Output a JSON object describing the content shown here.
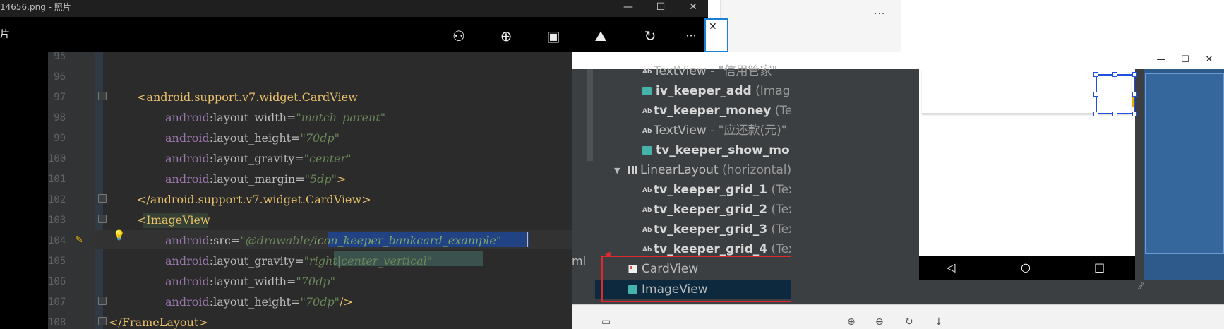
{
  "photos": {
    "title": "14656.png - 照片",
    "left_glyph": "片",
    "window_buttons": [
      "—",
      "☐",
      "✕"
    ],
    "toolbar_icons": [
      "share-icon",
      "zoom-icon",
      "slideshow-icon",
      "edit-icon",
      "rotate-icon",
      "more-icon"
    ],
    "toolbar_glyphs": [
      "⚇",
      "⊕",
      "▣",
      "⛰",
      "↻",
      "···"
    ]
  },
  "editor": {
    "lines": [
      {
        "n": "95"
      },
      {
        "n": "96"
      },
      {
        "n": "97",
        "open": "<",
        "tag": "android.support.v7.widget.CardView"
      },
      {
        "n": "98",
        "ns": "android",
        "attr": "layout_width",
        "val": "\"match_parent\""
      },
      {
        "n": "99",
        "ns": "android",
        "attr": "layout_height",
        "val": "\"70dp\""
      },
      {
        "n": "100",
        "ns": "android",
        "attr": "layout_gravity",
        "val": "\"center\""
      },
      {
        "n": "101",
        "ns": "android",
        "attr": "layout_margin",
        "val": "\"5dp\"",
        "end": ">"
      },
      {
        "n": "102",
        "close": "</android.support.v7.widget.CardView>"
      },
      {
        "n": "103",
        "open": "<",
        "tag": "ImageView"
      },
      {
        "n": "104",
        "ns": "android",
        "attr": "src",
        "val_a": "\"@drawable/",
        "val_b": "icon_keeper_bankcard_example",
        "val_c": "\""
      },
      {
        "n": "105",
        "ns": "android",
        "attr": "layout_gravity",
        "val_q1": "\"",
        "val_mid": "right|center_vertical",
        "val_q2": "\""
      },
      {
        "n": "106",
        "ns": "android",
        "attr": "layout_width",
        "val": "\"70dp\""
      },
      {
        "n": "107",
        "ns": "android",
        "attr": "layout_height",
        "val": "\"70dp\"",
        "end": "/>"
      },
      {
        "n": "108",
        "close": "</FrameLayout>"
      }
    ],
    "colon": ":",
    "eq": "="
  },
  "component_tree": {
    "side_label": "ml",
    "rows": [
      {
        "icon": "text",
        "name": "TextView",
        "meta": " - \"信用管家\"",
        "bold": false
      },
      {
        "icon": "image",
        "name": "iv_keeper_add",
        "meta": " (ImageVie",
        "bold": true
      },
      {
        "icon": "text",
        "name": "tv_keeper_money",
        "meta": " (TextV",
        "bold": true
      },
      {
        "icon": "text",
        "name": "TextView",
        "meta": " - \"应还款(元)\"",
        "bold": false
      },
      {
        "icon": "image",
        "name": "tv_keeper_show_money",
        "meta": "",
        "bold": true
      },
      {
        "icon": "linear",
        "name": "LinearLayout",
        "meta": " (horizontal)",
        "bold": false
      },
      {
        "icon": "text",
        "name": "tv_keeper_grid_1",
        "meta": " (TextVi",
        "bold": true
      },
      {
        "icon": "text",
        "name": "tv_keeper_grid_2",
        "meta": " (TextVi",
        "bold": true
      },
      {
        "icon": "text",
        "name": "tv_keeper_grid_3",
        "meta": " (TextVi",
        "bold": true
      },
      {
        "icon": "text",
        "name": "tv_keeper_grid_4",
        "meta": " (TextVi",
        "bold": true
      },
      {
        "icon": "card",
        "name": "CardView",
        "meta": "",
        "bold": false
      },
      {
        "icon": "image",
        "name": "ImageView",
        "meta": "",
        "bold": false
      }
    ],
    "ab_glyph": "Ab"
  },
  "as_window": {
    "buttons": [
      "—",
      "☐",
      "✕"
    ]
  },
  "nav": {
    "back": "◁",
    "home": "○",
    "recent": "□"
  },
  "bottom_icons": [
    "⊕",
    "⊖",
    "↻",
    "↓",
    "▭"
  ],
  "bg_dots": "···",
  "close_x": "✕",
  "colors": {
    "accent": "#1f51e0",
    "highlight_box": "#e0282e",
    "editor_bg": "#2b2b2b"
  }
}
